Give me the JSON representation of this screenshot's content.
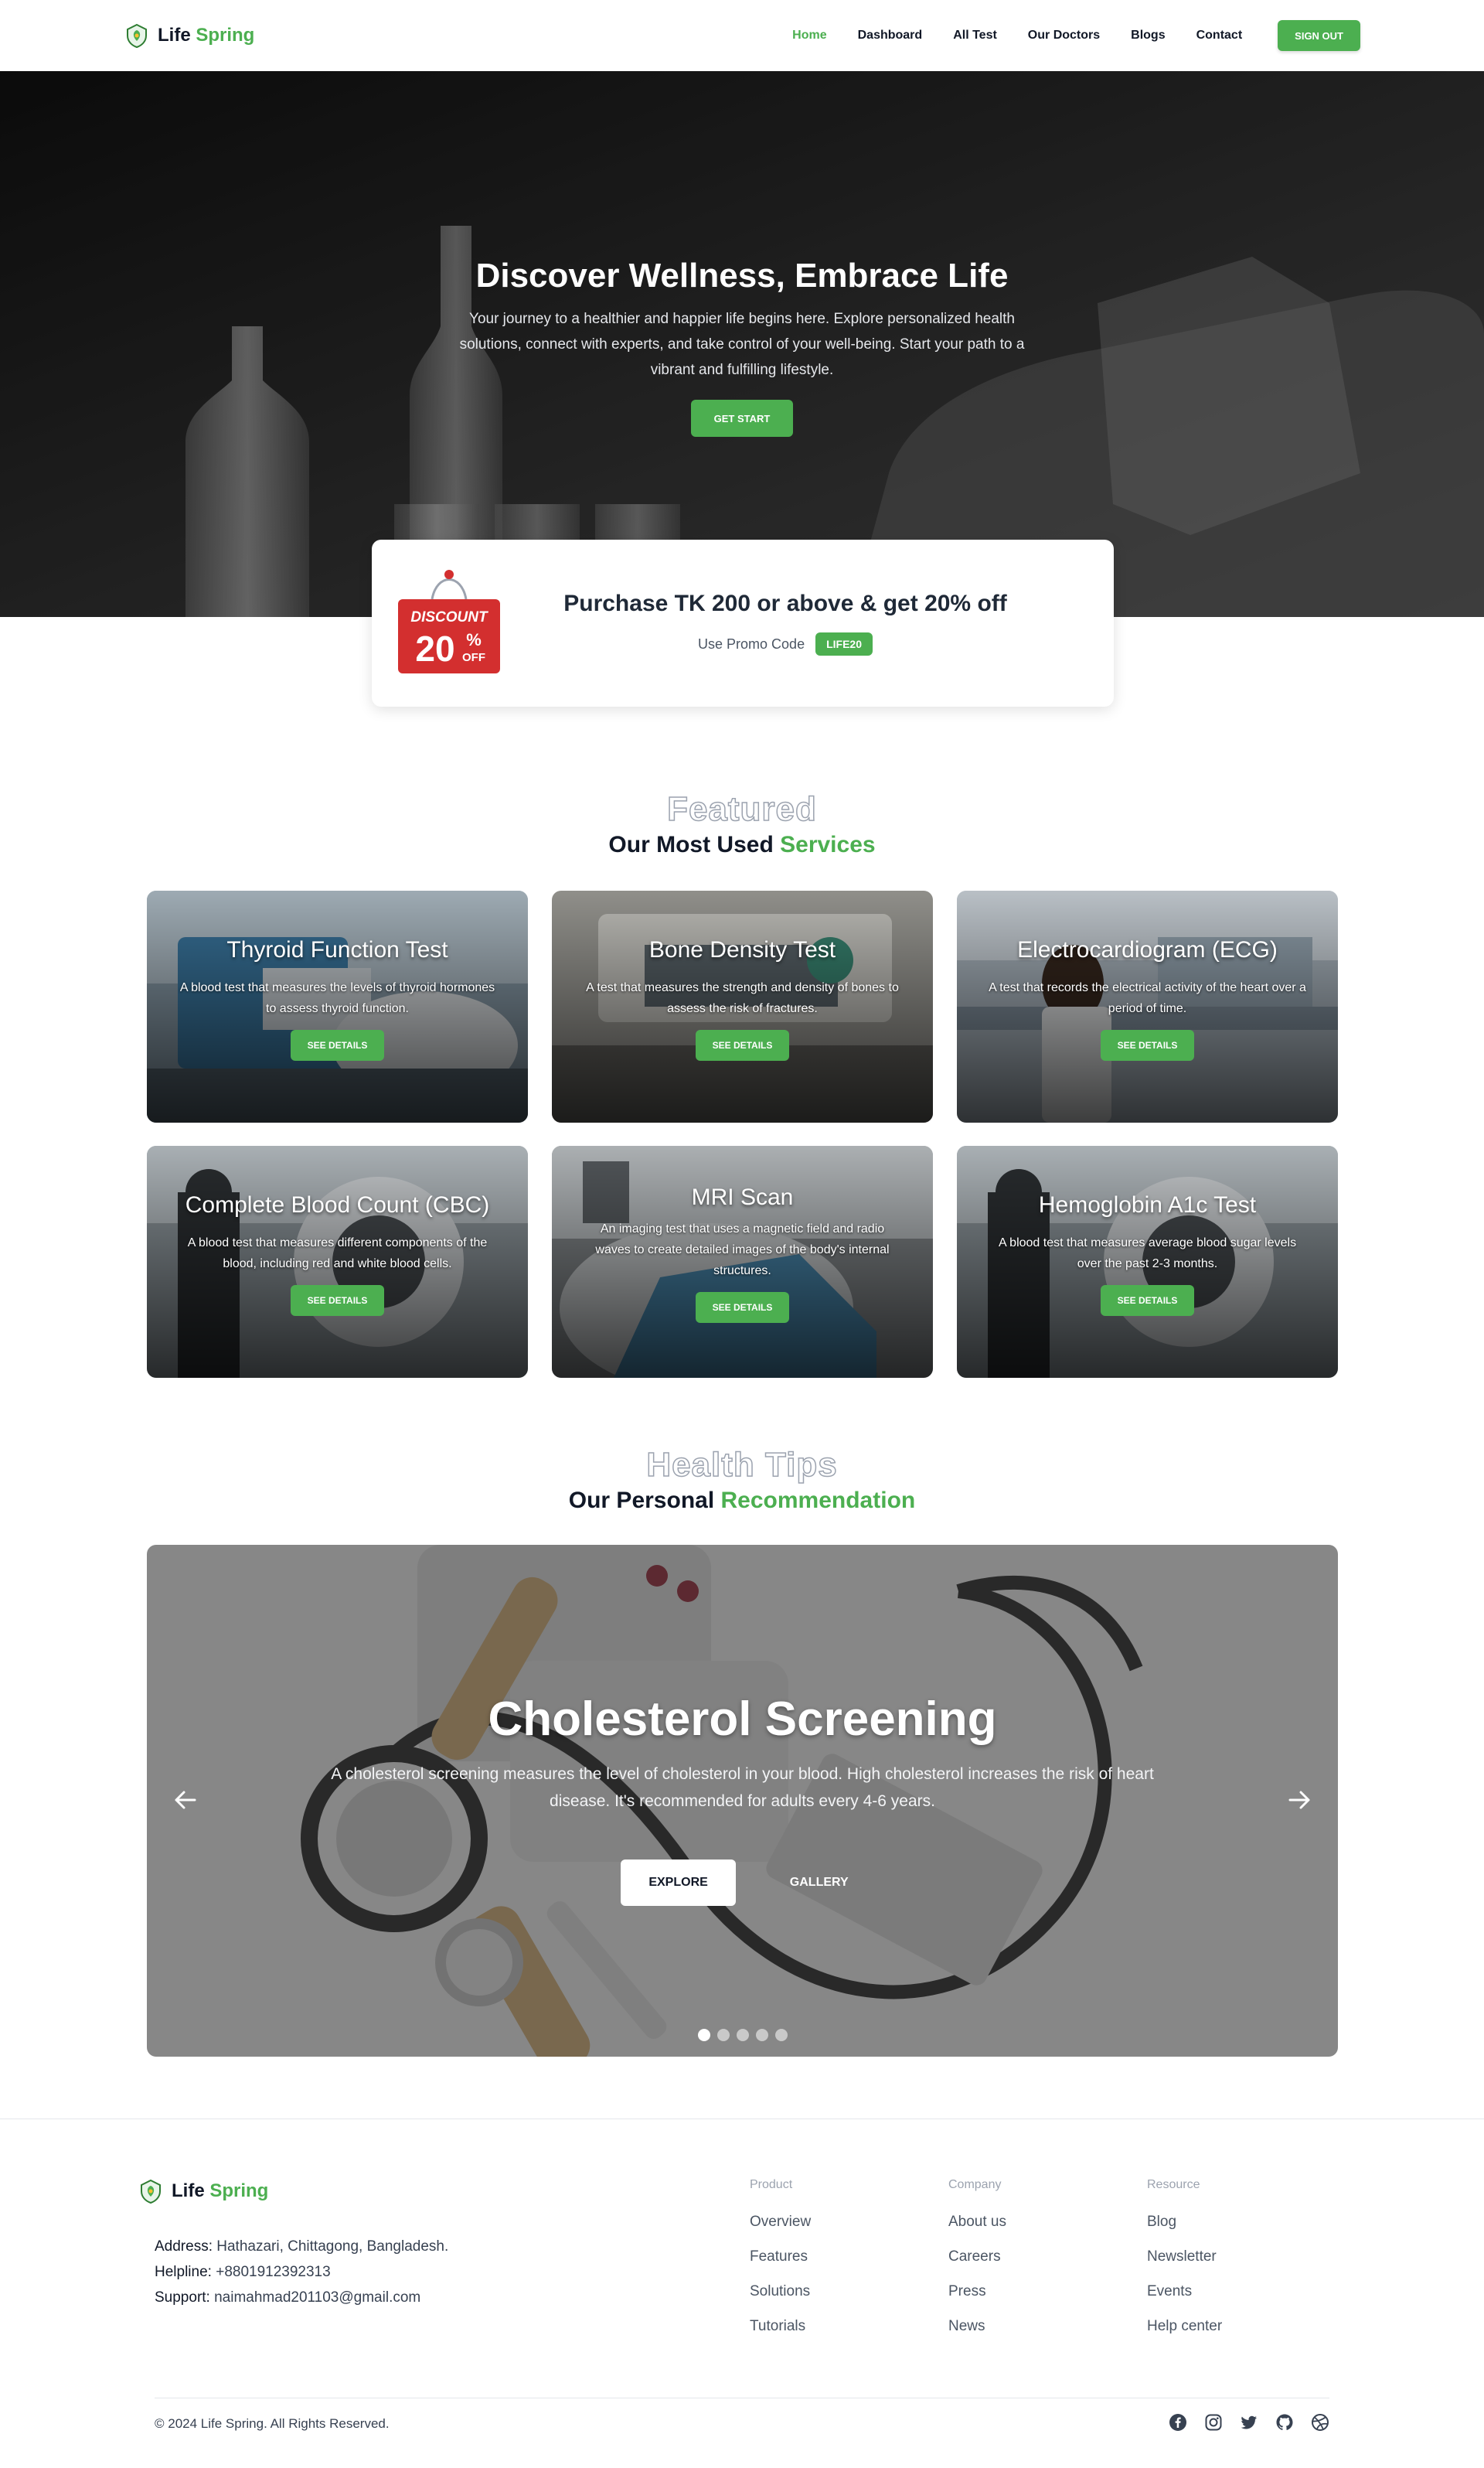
{
  "brand": {
    "name_part1": "Life",
    "name_part2": "Spring"
  },
  "nav": {
    "links": [
      "Home",
      "Dashboard",
      "All Test",
      "Our Doctors",
      "Blogs",
      "Contact"
    ],
    "signout_label": "SIGN OUT"
  },
  "hero": {
    "title": "Discover Wellness, Embrace Life",
    "subtitle": "Your journey to a healthier and happier life begins here. Explore personalized health solutions, connect with experts, and take control of your well-being. Start your path to a vibrant and fulfilling lifestyle.",
    "button_label": "GET START"
  },
  "promo": {
    "tag_word": "DISCOUNT",
    "tag_number": "20",
    "tag_percent": "%",
    "tag_off": "OFF",
    "title": "Purchase TK 200 or above & get 20% off",
    "code_label": "Use Promo Code",
    "code": "LIFE20"
  },
  "services": {
    "outline_title": "Featured",
    "title_part1": "Our Most Used",
    "title_part2": "Services",
    "button_label": "SEE DETAILS",
    "cards": [
      {
        "title": "Thyroid Function Test",
        "desc": "A blood test that measures the levels of thyroid hormones to assess thyroid function."
      },
      {
        "title": "Bone Density Test",
        "desc": "A test that measures the strength and density of bones to assess the risk of fractures."
      },
      {
        "title": "Electrocardiogram (ECG)",
        "desc": "A test that records the electrical activity of the heart over a period of time."
      },
      {
        "title": "Complete Blood Count (CBC)",
        "desc": "A blood test that measures different components of the blood, including red and white blood cells."
      },
      {
        "title": "MRI Scan",
        "desc": "An imaging test that uses a magnetic field and radio waves to create detailed images of the body's internal structures."
      },
      {
        "title": "Hemoglobin A1c Test",
        "desc": "A blood test that measures average blood sugar levels over the past 2-3 months."
      }
    ]
  },
  "tips": {
    "outline_title": "Health Tips",
    "title_part1": "Our Personal",
    "title_part2": "Recommendation",
    "slide_title": "Cholesterol Screening",
    "slide_desc": "A cholesterol screening measures the level of cholesterol in your blood. High cholesterol increases the risk of heart disease. It's recommended for adults every 4-6 years.",
    "explore_label": "EXPLORE",
    "gallery_label": "GALLERY",
    "active_slide": 1,
    "slide_count": 5
  },
  "footer": {
    "address_label": "Address:",
    "address": "Hathazari, Chittagong, Bangladesh.",
    "helpline_label": "Helpline:",
    "helpline": "+8801912392313",
    "support_label": "Support:",
    "support": "naimahmad201103@gmail.com",
    "columns": [
      {
        "title": "Product",
        "links": [
          "Overview",
          "Features",
          "Solutions",
          "Tutorials"
        ]
      },
      {
        "title": "Company",
        "links": [
          "About us",
          "Careers",
          "Press",
          "News"
        ]
      },
      {
        "title": "Resource",
        "links": [
          "Blog",
          "Newsletter",
          "Events",
          "Help center"
        ]
      }
    ],
    "copyright": "© 2024 Life Spring. All Rights Reserved.",
    "socials": [
      "facebook-icon",
      "instagram-icon",
      "twitter-icon",
      "github-icon",
      "dribbble-icon"
    ]
  },
  "colors": {
    "accent": "#4caf50",
    "promo_tag": "#d32f2f"
  }
}
